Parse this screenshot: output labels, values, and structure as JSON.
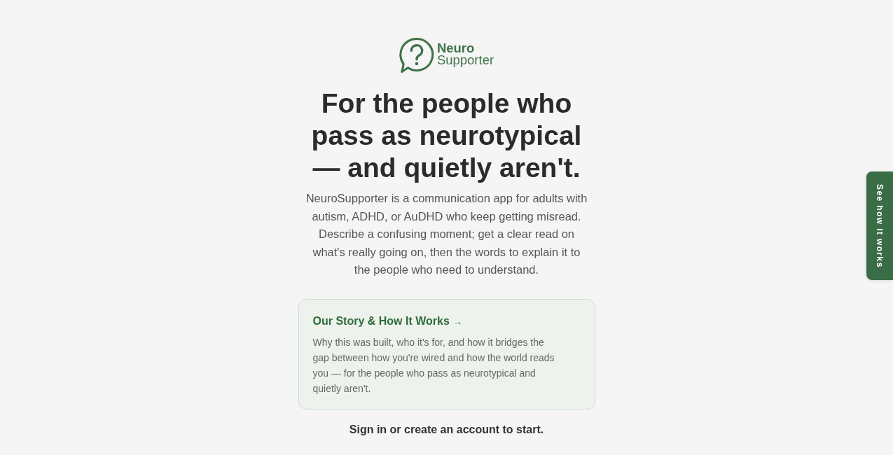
{
  "logo": {
    "line_1": "Neuro",
    "line_2": "Supporter"
  },
  "headline": "For the people who pass as neurotypical — and quietly aren't.",
  "intro": "NeuroSupporter is a communication app for adults with autism, ADHD, or AuDHD who keep getting misread. Describe a confusing moment; get a clear read on what's really going on, then the words to explain it to the people who need to understand.",
  "story_card": {
    "title": "Our Story & How It Works",
    "arrow": "→",
    "description": "Why this was built, who it's for, and how it bridges the gap between how you're wired and how the world reads you — for the people who pass as neurotypical and quietly aren't."
  },
  "sign_in_prompt": "Sign in or create an account to start.",
  "side_tab": {
    "label": "See how it works"
  }
}
